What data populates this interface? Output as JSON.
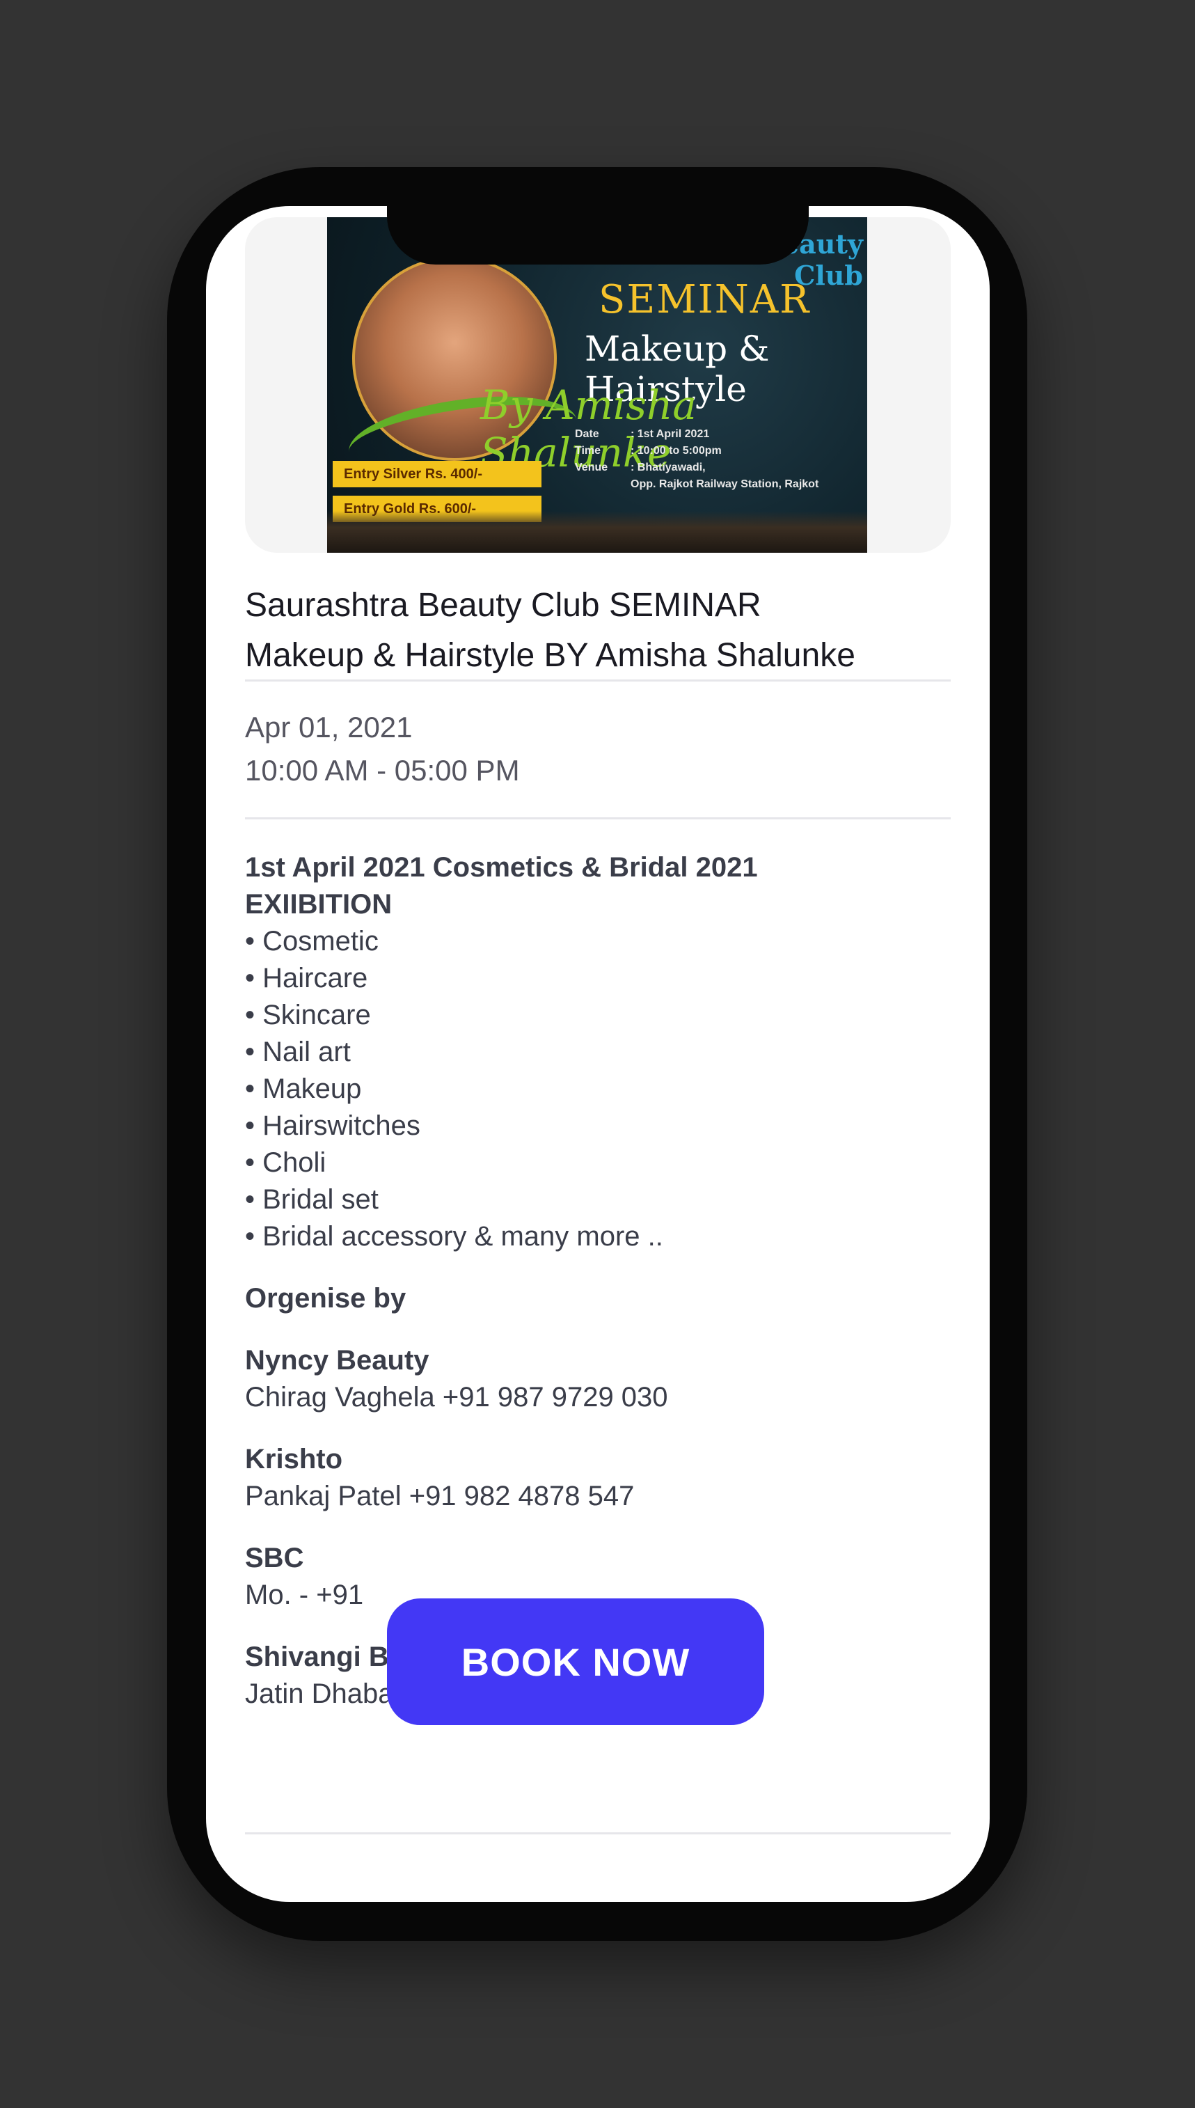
{
  "event": {
    "title_line1": "Saurashtra Beauty Club SEMINAR",
    "title_line2": "Makeup & Hairstyle BY Amisha Shalunke",
    "date": "Apr 01, 2021",
    "time": "10:00 AM - 05:00 PM"
  },
  "poster": {
    "club": "Saurashtra Beauty Club",
    "seminar": "SEMINAR",
    "subtitle": "Makeup & Hairstyle",
    "by": "By Amisha Shalunke",
    "date_label": "Date",
    "date_value": ": 1st April 2021",
    "time_label": "Time",
    "time_value": ": 10:00 to 5:00pm",
    "venue_label": "Venue",
    "venue_value": ": Bhatiyawadi,",
    "venue_value2": "Opp. Rajkot Railway Station, Rajkot",
    "entry_silver": "Entry Silver Rs. 400/-",
    "entry_gold": "Entry Gold Rs. 600/-"
  },
  "description": {
    "heading_line1": "1st April 2021 Cosmetics & Bridal 2021",
    "heading_line2": "EXIIBITION",
    "items": [
      "• Cosmetic",
      "• Haircare",
      "• Skincare",
      "• Nail art",
      "• Makeup",
      "• Hairswitches",
      "• Choli",
      "• Bridal set",
      "• Bridal accessory & many more .."
    ],
    "organise_heading": "Orgenise by",
    "organisers": [
      {
        "name": "Nyncy Beauty",
        "contact": "Chirag Vaghela +91 987 9729 030"
      },
      {
        "name": "Krishto",
        "contact": "Pankaj Patel +91 982 4878 547"
      },
      {
        "name": "SBC",
        "contact": "Mo. - +91"
      },
      {
        "name": "Shivangi Beauty Collaction",
        "contact": "Jatin Dhabaliya +91 937 5711 666"
      }
    ]
  },
  "actions": {
    "book_now": "BOOK NOW"
  },
  "colors": {
    "accent": "#4338f5",
    "background": "#333333",
    "text": "#3a3d49"
  }
}
